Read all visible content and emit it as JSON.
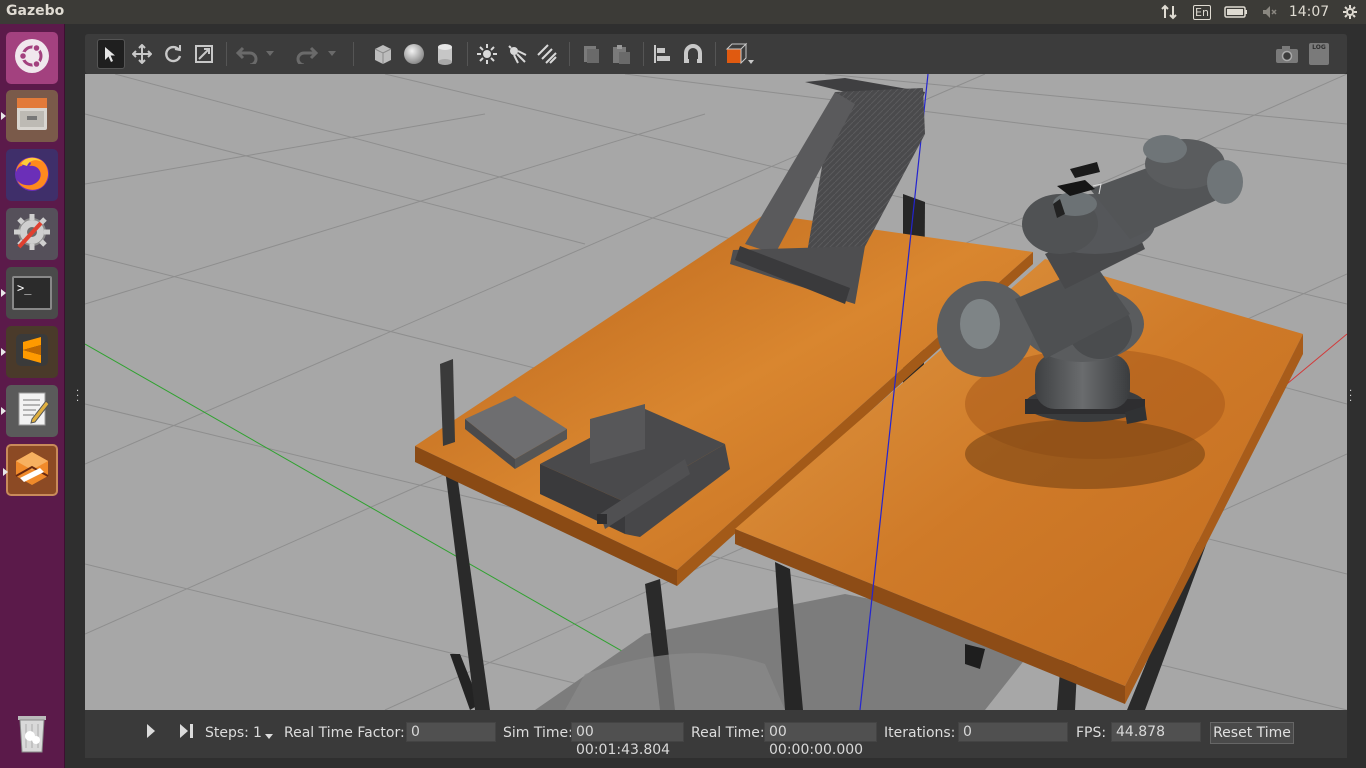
{
  "top_panel": {
    "app_title": "Gazebo",
    "keyboard": "En",
    "clock": "14:07"
  },
  "launcher": {
    "items": [
      {
        "icon": "ubuntu-dash-icon"
      },
      {
        "icon": "files-icon"
      },
      {
        "icon": "firefox-icon"
      },
      {
        "icon": "system-settings-icon"
      },
      {
        "icon": "terminal-icon"
      },
      {
        "icon": "sublime-text-icon"
      },
      {
        "icon": "text-editor-icon"
      },
      {
        "icon": "gazebo-icon"
      },
      {
        "icon": "trash-icon"
      }
    ],
    "terminal_prompt": ">_"
  },
  "toolbar": {
    "tools": [
      "select-mode-icon",
      "translate-mode-icon",
      "rotate-mode-icon",
      "scale-mode-icon",
      "undo-icon",
      "redo-icon",
      "box-shape-icon",
      "sphere-shape-icon",
      "cylinder-shape-icon",
      "point-light-icon",
      "spot-light-icon",
      "directional-light-icon",
      "copy-icon",
      "paste-icon",
      "align-icon",
      "snap-icon",
      "view-angle-icon"
    ],
    "right_tools": [
      "screenshot-icon",
      "log-icon"
    ],
    "log_label": "LOG"
  },
  "bottom_bar": {
    "steps_label": "Steps:",
    "steps_value": "1",
    "rtf_label": "Real Time Factor:",
    "rtf_value": "0",
    "sim_time_label": "Sim Time:",
    "sim_time_value": "00 00:01:43.804",
    "real_time_label": "Real Time:",
    "real_time_value": "00 00:00:00.000",
    "iterations_label": "Iterations:",
    "iterations_value": "0",
    "fps_label": "FPS:",
    "fps_value": "44.878",
    "reset_label": "Reset Time"
  },
  "colors": {
    "launcher_bg": "#5b1a4a",
    "panel_bg": "#3c3b37",
    "viewport_bg": "#a7a7a7",
    "table_wood": "#c9741f",
    "robot_gray": "#56585a",
    "accent_orange": "#e05a10"
  }
}
